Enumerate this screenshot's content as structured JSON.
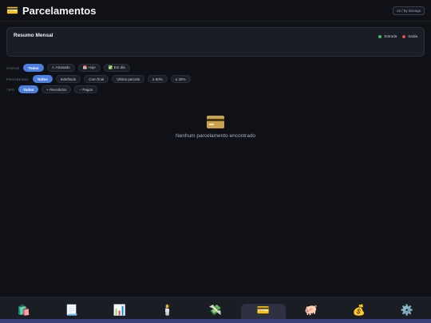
{
  "header": {
    "title": "Parcelamentos",
    "icon": "credit-card-icon",
    "version": "v2 / by Zenaqa"
  },
  "summary": {
    "title": "Resumo Mensal",
    "legend": [
      {
        "label": "Entrada",
        "color": "#3fbf5a"
      },
      {
        "label": "Saída",
        "color": "#e0504a"
      }
    ]
  },
  "filters": {
    "status": {
      "label": "STATUS",
      "options": [
        "Todos",
        "⚠ Atrasado",
        "📅 Hoje",
        "✅ Em dia"
      ],
      "active": "Todos"
    },
    "progress": {
      "label": "PROGRESSO",
      "options": [
        "Todos",
        "Indefinido",
        "Com final",
        "Última parcela",
        "≥ 60%",
        "≤ 30%"
      ],
      "active": "Todos"
    },
    "type": {
      "label": "TIPO",
      "options": [
        "Todos",
        "+ Recebidos",
        "− Pagos"
      ],
      "active": "Todos"
    }
  },
  "empty": {
    "icon": "credit-card-icon",
    "text": "Nenhum parcelamento encontrado"
  },
  "nav": {
    "items": [
      {
        "icon": "🛍️",
        "name": "shopping-bags-icon"
      },
      {
        "icon": "📃",
        "name": "document-icon"
      },
      {
        "icon": "📊",
        "name": "bar-chart-icon"
      },
      {
        "icon": "🕯️",
        "name": "candle-icon"
      },
      {
        "icon": "💸",
        "name": "money-wings-icon"
      },
      {
        "icon": "💳",
        "name": "credit-card-icon"
      },
      {
        "icon": "🐖",
        "name": "piggy-bank-icon"
      },
      {
        "icon": "💰",
        "name": "money-bag-icon"
      },
      {
        "icon": "⚙️",
        "name": "gear-icon"
      }
    ],
    "active_index": 5
  },
  "colors": {
    "accent": "#4d7fe0",
    "background": "#0f1117"
  }
}
